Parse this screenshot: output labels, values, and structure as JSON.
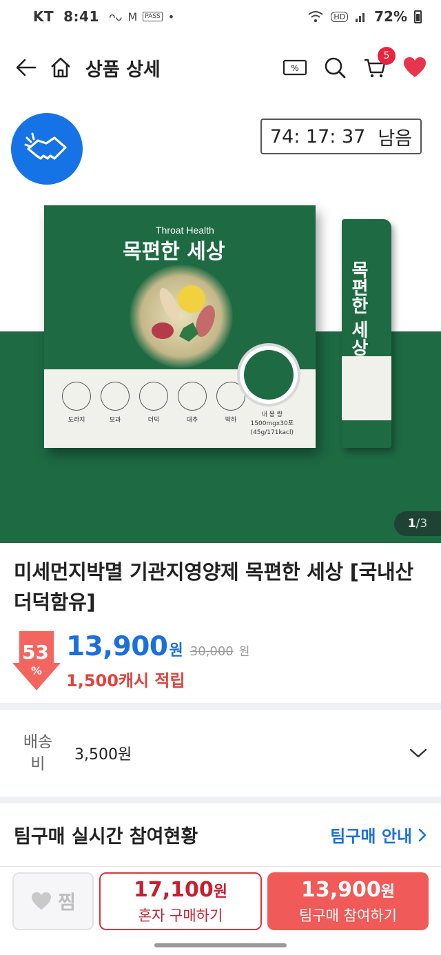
{
  "status_bar": {
    "carrier": "KT",
    "time": "8:41",
    "pass_label": "PASS",
    "battery": "72%"
  },
  "header": {
    "title": "상품 상세",
    "cart_count": "5"
  },
  "hero": {
    "timer_value": "74: 17: 37",
    "timer_suffix": "남음",
    "pager_current": "1",
    "pager_total": "/3",
    "package": {
      "brand_en": "Throat Health",
      "brand_ko": "목편한 세상",
      "stick_text": "목편한 세상",
      "herbs": [
        "도라지",
        "모과",
        "더덕",
        "대추",
        "박하"
      ],
      "info_title": "내 용 량",
      "info_amount": "1500mgx30포",
      "info_weight": "(45g/171kacl)"
    }
  },
  "product": {
    "name": "미세먼지박멸 기관지영양제 목편한 세상 [국내산 더덕함유]",
    "discount_value": "53",
    "discount_unit": "%",
    "price": "13,900",
    "price_unit": "원",
    "original_price": "30,000",
    "original_unit": "원",
    "cash_reward": "1,500캐시 적립"
  },
  "shipping": {
    "label": "배송비",
    "value": "3,500원"
  },
  "team": {
    "title": "팀구매 실시간 참여현황",
    "guide": "팀구매 안내"
  },
  "bottom_bar": {
    "wish_label": "찜",
    "solo_price": "17,100",
    "solo_unit": "원",
    "solo_label": "혼자 구매하기",
    "team_price": "13,900",
    "team_unit": "원",
    "team_label": "팀구매 참여하기"
  },
  "colors": {
    "accent_blue": "#1a6fe0",
    "accent_red": "#e0433f",
    "product_green": "#1d6a43",
    "badge_red": "#e8253e"
  }
}
